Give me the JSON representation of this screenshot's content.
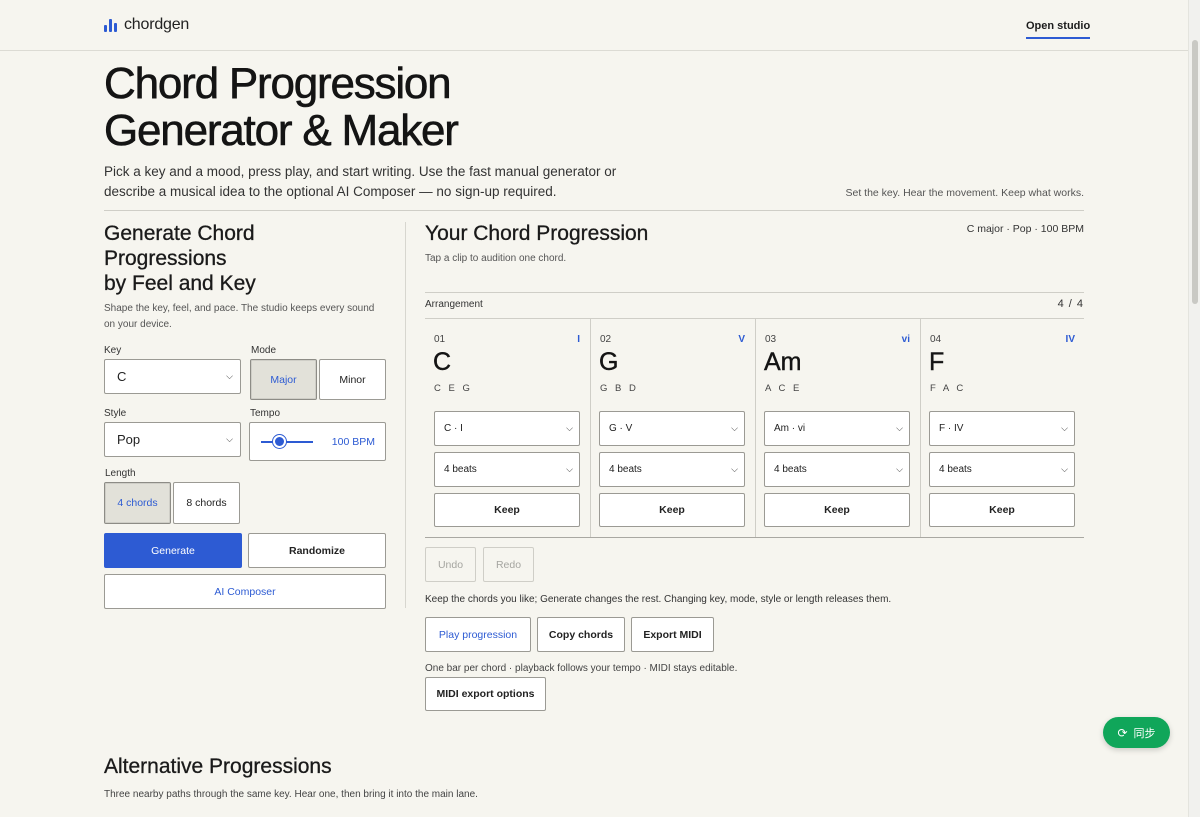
{
  "brand": {
    "name": "chordgen",
    "accent": "#2d5bd3"
  },
  "nav": {
    "open_studio": "Open studio"
  },
  "hero": {
    "title_line1": "Chord Progression",
    "title_line2": "Generator & Maker",
    "intro": "Pick a key and a mood, press play, and start writing. Use the fast manual generator or describe a musical idea to the optional AI Composer — no sign-up required.",
    "tagline": "Set the key. Hear the movement. Keep what works."
  },
  "generator": {
    "title_line1": "Generate Chord",
    "title_line2": "Progressions",
    "title_line3": "by Feel and Key",
    "subtitle": "Shape the key, feel, and pace. The studio keeps every sound on your device.",
    "key_label": "Key",
    "key_value": "C",
    "mode_label": "Mode",
    "mode_major": "Major",
    "mode_minor": "Minor",
    "style_label": "Style",
    "style_value": "Pop",
    "tempo_label": "Tempo",
    "tempo_value": "100 BPM",
    "tempo_level": 0.35,
    "length_label": "Length",
    "length_4": "4 chords",
    "length_8": "8 chords",
    "generate": "Generate",
    "randomize": "Randomize",
    "ai_composer": "AI Composer"
  },
  "progression": {
    "title": "Your Chord Progression",
    "meta": "C major · Pop · 100 BPM",
    "subtitle": "Tap a clip to audition one chord.",
    "arrangement_label": "Arrangement",
    "count": "4 / 4",
    "chords": [
      {
        "num": "01",
        "roman": "I",
        "name": "C",
        "notes": "C E G",
        "select": "C · I",
        "beats": "4 beats",
        "keep": "Keep"
      },
      {
        "num": "02",
        "roman": "V",
        "name": "G",
        "notes": "G B D",
        "select": "G · V",
        "beats": "4 beats",
        "keep": "Keep"
      },
      {
        "num": "03",
        "roman": "vi",
        "name": "Am",
        "notes": "A C E",
        "select": "Am · vi",
        "beats": "4 beats",
        "keep": "Keep"
      },
      {
        "num": "04",
        "roman": "IV",
        "name": "F",
        "notes": "F A C",
        "select": "F · IV",
        "beats": "4 beats",
        "keep": "Keep"
      }
    ],
    "undo": "Undo",
    "redo": "Redo",
    "help": "Keep the chords you like; Generate changes the rest. Changing key, mode, style or length releases them.",
    "play": "Play progression",
    "copy": "Copy chords",
    "export_midi": "Export MIDI",
    "play_note": "One bar per chord · playback follows your tempo · MIDI stays editable.",
    "midi_options": "MIDI export options"
  },
  "alternatives": {
    "title": "Alternative Progressions",
    "subtitle": "Three nearby paths through the same key. Hear one, then bring it into the main lane."
  },
  "sync": {
    "label": "同步",
    "icon": "sync-icon"
  }
}
